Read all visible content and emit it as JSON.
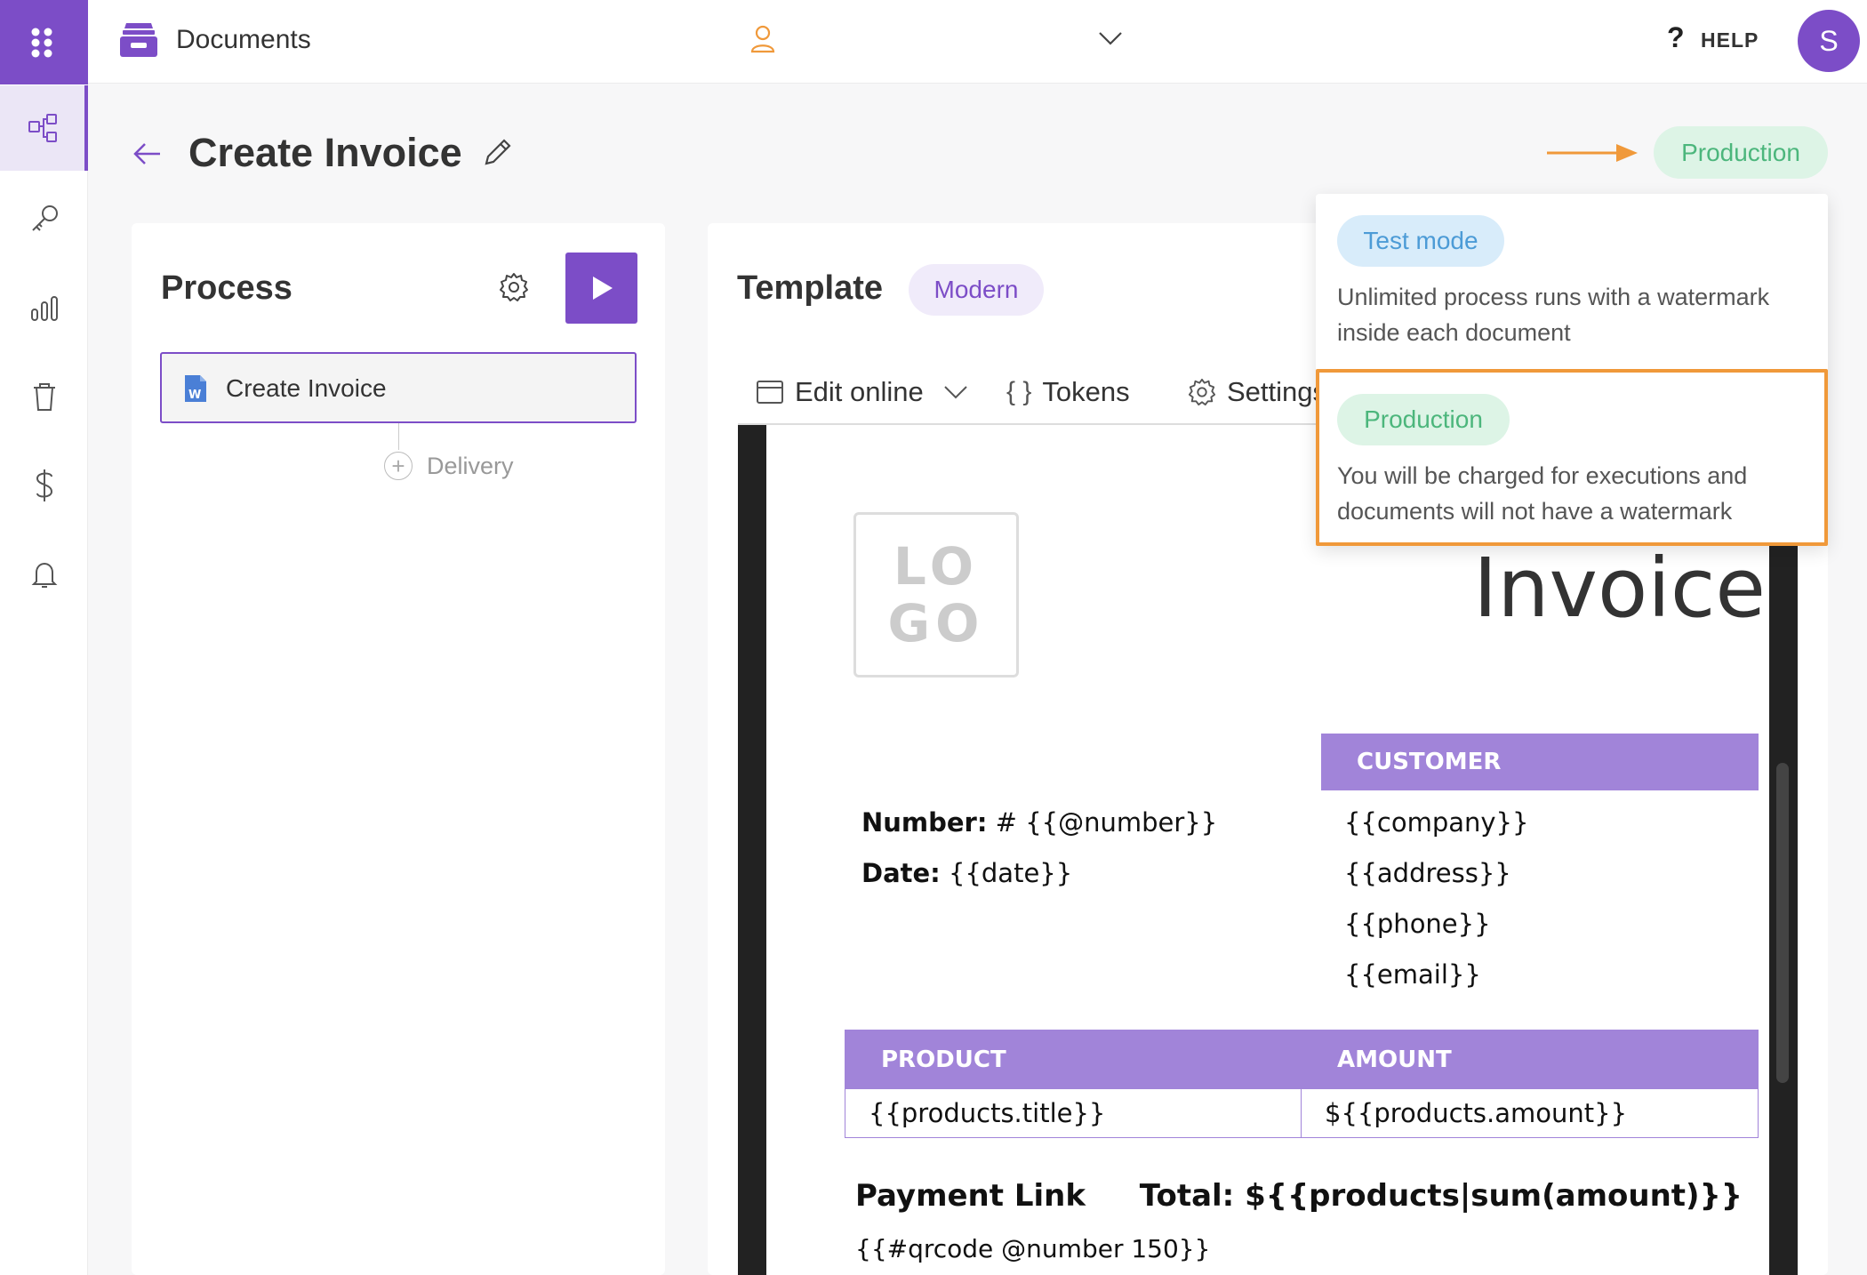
{
  "topbar": {
    "app_title": "Documents",
    "help_icon_glyph": "?",
    "help_label": "HELP",
    "avatar_initial": "S"
  },
  "sidebar": {
    "items": [
      {
        "icon": "workflow-icon",
        "active": true
      },
      {
        "icon": "key-icon",
        "active": false
      },
      {
        "icon": "bar-chart-icon",
        "active": false
      },
      {
        "icon": "trash-icon",
        "active": false
      },
      {
        "icon": "dollar-icon",
        "active": false
      },
      {
        "icon": "bell-icon",
        "active": false
      }
    ]
  },
  "header": {
    "title": "Create Invoice",
    "mode_badge": "Production"
  },
  "process": {
    "title": "Process",
    "step_label": "Create Invoice",
    "add_label": "Delivery"
  },
  "template": {
    "title": "Template",
    "style_badge": "Modern",
    "toolbar": {
      "edit_online": "Edit online",
      "tokens_glyph": "{ }",
      "tokens": "Tokens",
      "settings": "Settings"
    }
  },
  "document": {
    "logo_lines": [
      "LO",
      "GO"
    ],
    "heading": "Invoice",
    "customer_header": "CUSTOMER",
    "number_label": "Number:",
    "number_value": " # {{@number}}",
    "date_label": "Date:",
    "date_value": " {{date}}",
    "customer_fields": [
      "{{company}}",
      "{{address}}",
      "{{phone}}",
      "{{email}}"
    ],
    "table": {
      "headers": [
        "PRODUCT",
        "AMOUNT"
      ],
      "row": [
        "{{products.title}}",
        "${{products.amount}}"
      ]
    },
    "payment_link": "Payment Link",
    "total": "Total: ${{products|sum(amount)}}",
    "qrcode": "{{#qrcode @number 150}}"
  },
  "mode_dropdown": {
    "options": [
      {
        "label": "Test mode",
        "description": "Unlimited process runs with a watermark inside each document"
      },
      {
        "label": "Production",
        "description": "You will be charged for executions and documents will not have a watermark",
        "highlighted": true
      }
    ]
  },
  "colors": {
    "accent": "#7c4dc7",
    "production_green": "#4cb67c",
    "test_blue": "#4c9bd6",
    "highlight_orange": "#f0993a",
    "table_purple": "#a184d9"
  }
}
